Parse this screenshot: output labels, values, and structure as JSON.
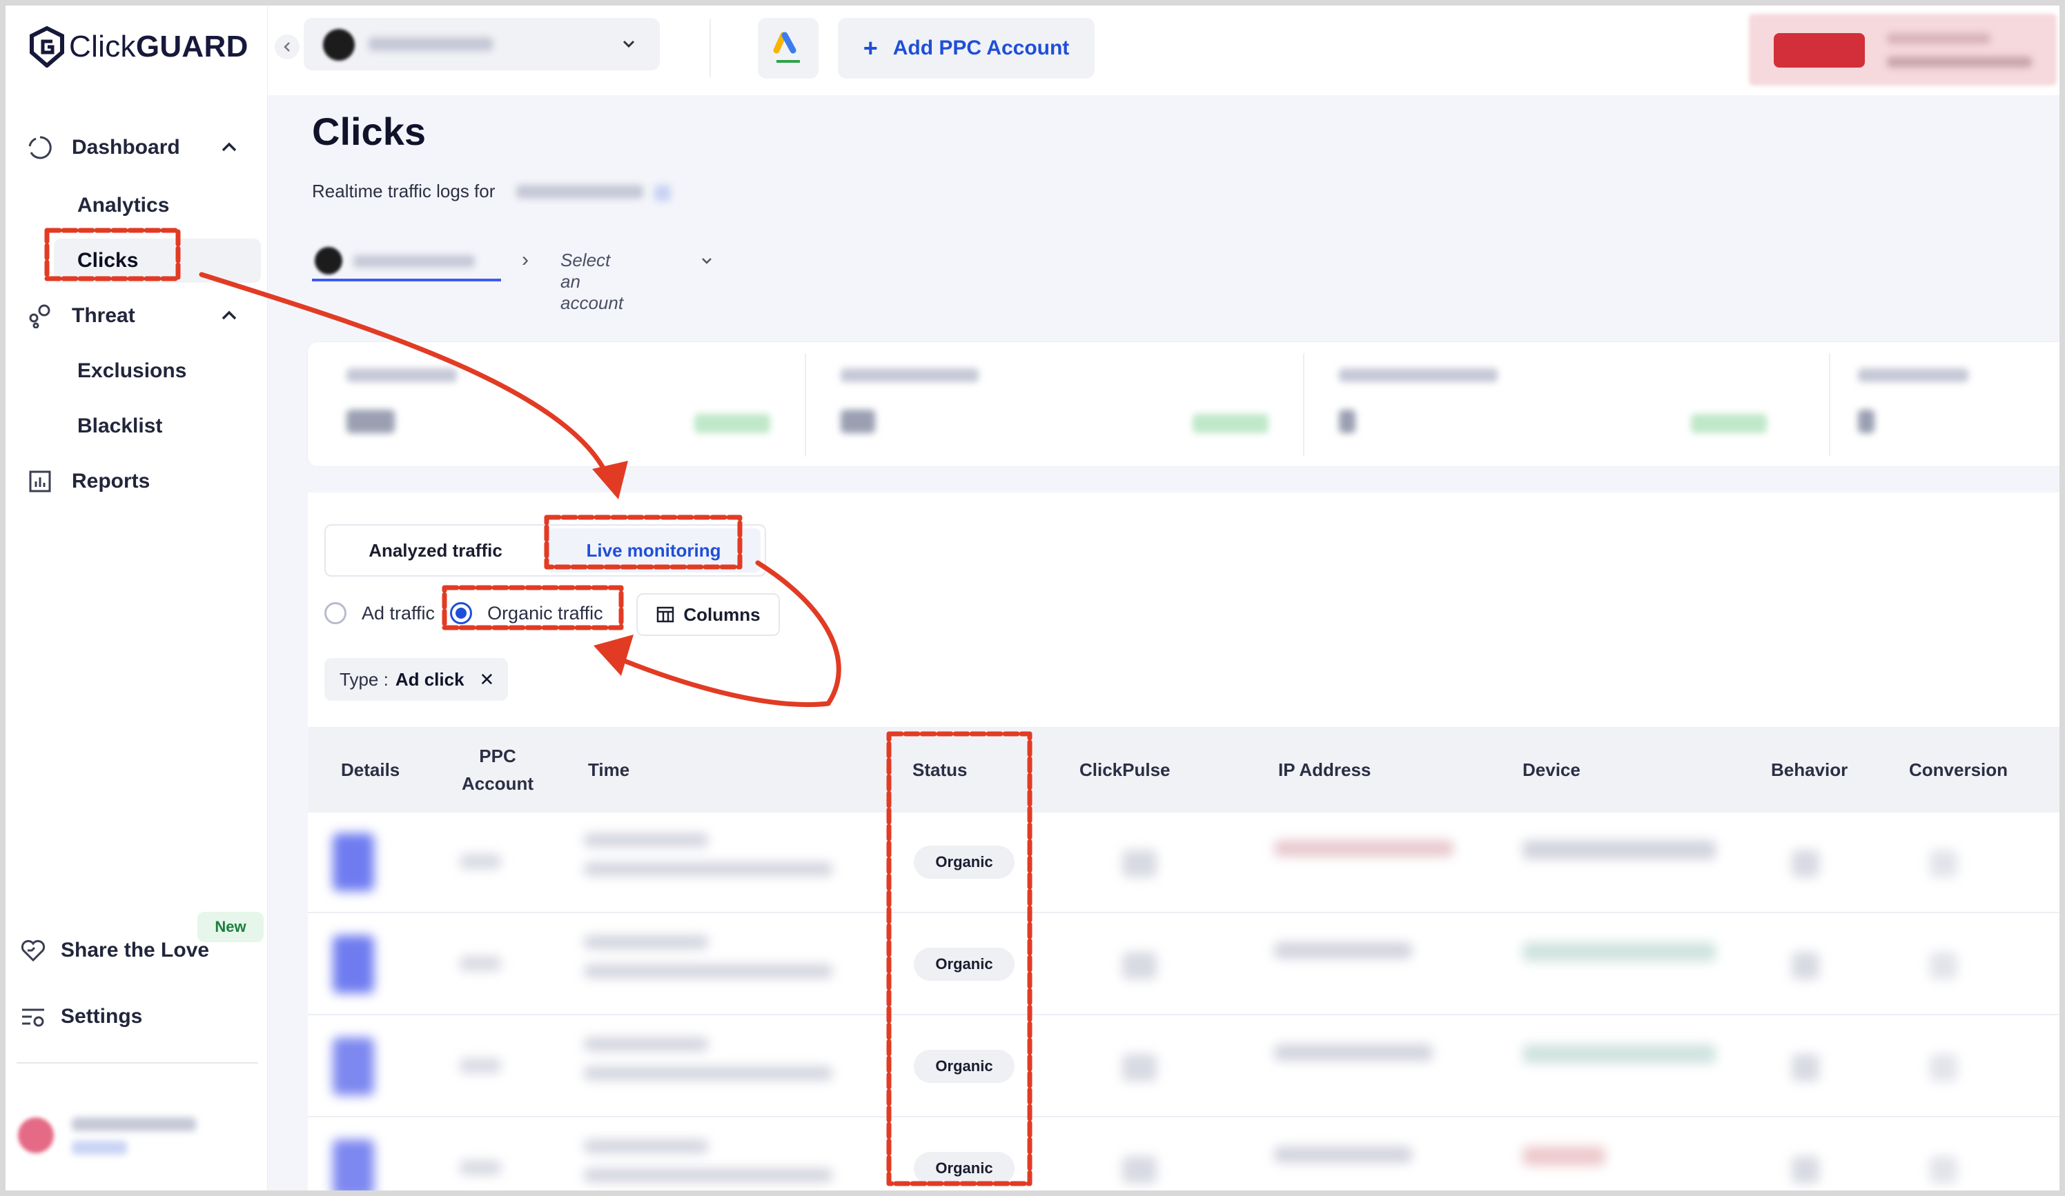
{
  "app": {
    "logo_text_light": "Click",
    "logo_text_bold": "GUARD"
  },
  "sidebar": {
    "dashboard": "Dashboard",
    "analytics": "Analytics",
    "clicks": "Clicks",
    "threat": "Threat",
    "exclusions": "Exclusions",
    "blacklist": "Blacklist",
    "reports": "Reports",
    "share": "Share the Love",
    "share_badge": "New",
    "settings": "Settings"
  },
  "topbar": {
    "add_ppc_label": "Add PPC Account"
  },
  "page": {
    "title": "Clicks",
    "subtitle": "Realtime traffic logs for"
  },
  "breadcrumb": {
    "select_placeholder": "Select an account"
  },
  "tabs": {
    "analyzed": "Analyzed traffic",
    "live": "Live monitoring",
    "active": "live"
  },
  "traffic_filter": {
    "ad": "Ad traffic",
    "organic": "Organic traffic",
    "selected": "organic",
    "columns_label": "Columns"
  },
  "filter_chip": {
    "key": "Type :",
    "value": "Ad click"
  },
  "table": {
    "columns": {
      "details": "Details",
      "ppc_line1": "PPC",
      "ppc_line2": "Account",
      "time": "Time",
      "status": "Status",
      "clickpulse": "ClickPulse",
      "ip": "IP Address",
      "device": "Device",
      "behavior": "Behavior",
      "conversion": "Conversion"
    },
    "rows": [
      {
        "status": "Organic"
      },
      {
        "status": "Organic"
      },
      {
        "status": "Organic"
      },
      {
        "status": "Organic"
      }
    ]
  },
  "colors": {
    "accent": "#1f4fd8",
    "annotation": "#e23b24",
    "exit_button": "#d32f3a"
  }
}
